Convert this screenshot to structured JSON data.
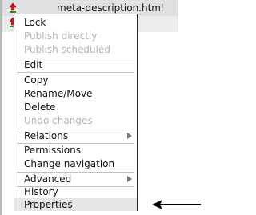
{
  "file_list": {
    "rows": [
      {
        "icon": "upload-file-icon",
        "name": "meta-description.html"
      },
      {
        "icon": "upload-file-icon",
        "name": ""
      }
    ]
  },
  "context_menu": {
    "items": [
      {
        "label": "Lock",
        "enabled": true
      },
      {
        "label": "Publish directly",
        "enabled": false
      },
      {
        "label": "Publish scheduled",
        "enabled": false
      },
      {
        "label": "Edit",
        "enabled": true
      },
      {
        "label": "Copy",
        "enabled": true
      },
      {
        "label": "Rename/Move",
        "enabled": true
      },
      {
        "label": "Delete",
        "enabled": true
      },
      {
        "label": "Undo changes",
        "enabled": false
      },
      {
        "label": "Relations",
        "enabled": true,
        "submenu": true
      },
      {
        "label": "Permissions",
        "enabled": true
      },
      {
        "label": "Change navigation",
        "enabled": true
      },
      {
        "label": "Advanced",
        "enabled": true,
        "submenu": true
      },
      {
        "label": "History",
        "enabled": true
      },
      {
        "label": "Properties",
        "enabled": true,
        "highlighted": true
      }
    ]
  },
  "annotation": {
    "icon": "arrow-left-icon",
    "color": "#000000"
  },
  "colors": {
    "disabled_text": "#b4b4b4",
    "highlight": "#e6e6e6",
    "row_background": "#e0e0e0"
  }
}
